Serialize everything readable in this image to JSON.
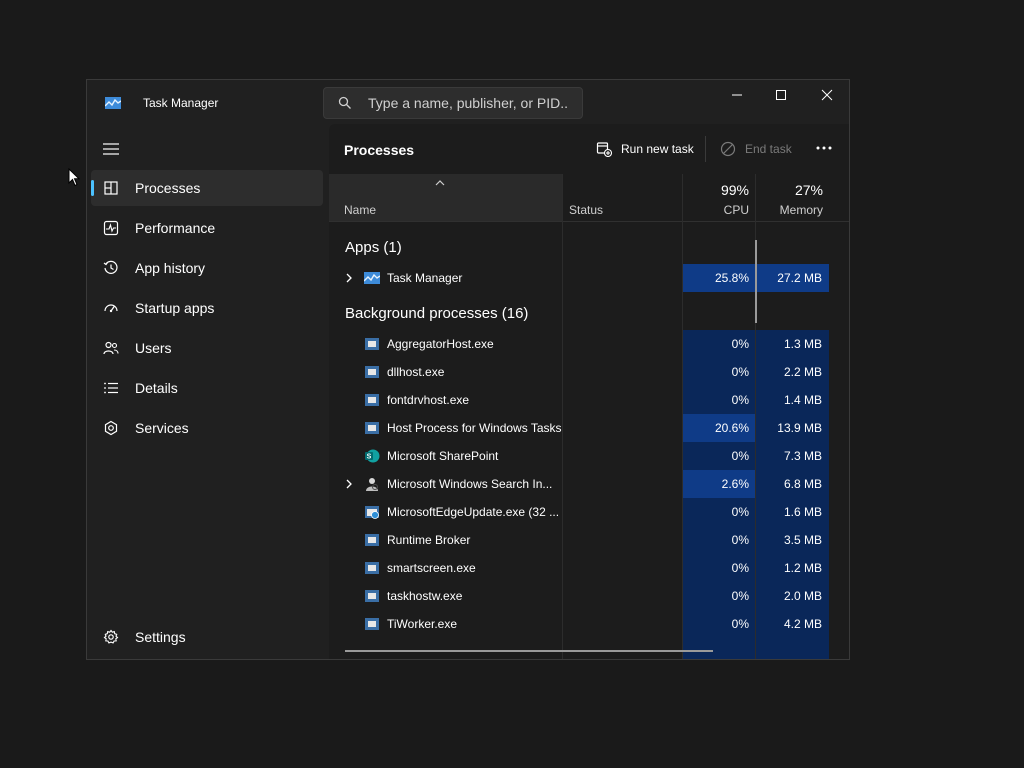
{
  "window": {
    "title": "Task Manager",
    "search_placeholder": "Type a name, publisher, or PID..."
  },
  "sidebar": {
    "items": [
      {
        "label": "Processes",
        "icon": "processes-icon"
      },
      {
        "label": "Performance",
        "icon": "performance-icon"
      },
      {
        "label": "App history",
        "icon": "history-icon"
      },
      {
        "label": "Startup apps",
        "icon": "startup-icon"
      },
      {
        "label": "Users",
        "icon": "users-icon"
      },
      {
        "label": "Details",
        "icon": "details-icon"
      },
      {
        "label": "Services",
        "icon": "services-icon"
      }
    ],
    "settings_label": "Settings",
    "active": "Processes"
  },
  "toolbar": {
    "page_title": "Processes",
    "run_new_task": "Run new task",
    "end_task": "End task"
  },
  "columns": {
    "name": "Name",
    "status": "Status",
    "cpu_label": "CPU",
    "cpu_total": "99%",
    "memory_label": "Memory",
    "memory_total": "27%"
  },
  "groups": {
    "apps": "Apps (1)",
    "background": "Background processes (16)"
  },
  "apps": [
    {
      "name": "Task Manager",
      "cpu": "25.8%",
      "memory": "27.2 MB",
      "expandable": true,
      "icon": "task-manager-icon"
    }
  ],
  "background": [
    {
      "name": "AggregatorHost.exe",
      "cpu": "0%",
      "memory": "1.3 MB",
      "expandable": false,
      "icon": "process-icon"
    },
    {
      "name": "dllhost.exe",
      "cpu": "0%",
      "memory": "2.2 MB",
      "expandable": false,
      "icon": "process-icon"
    },
    {
      "name": "fontdrvhost.exe",
      "cpu": "0%",
      "memory": "1.4 MB",
      "expandable": false,
      "icon": "process-icon"
    },
    {
      "name": "Host Process for Windows Tasks",
      "cpu": "20.6%",
      "memory": "13.9 MB",
      "expandable": false,
      "icon": "process-icon"
    },
    {
      "name": "Microsoft SharePoint",
      "cpu": "0%",
      "memory": "7.3 MB",
      "expandable": false,
      "icon": "sharepoint-icon"
    },
    {
      "name": "Microsoft Windows Search In...",
      "cpu": "2.6%",
      "memory": "6.8 MB",
      "expandable": true,
      "icon": "search-indexer-icon"
    },
    {
      "name": "MicrosoftEdgeUpdate.exe (32 ...",
      "cpu": "0%",
      "memory": "1.6 MB",
      "expandable": false,
      "icon": "edge-update-icon"
    },
    {
      "name": "Runtime Broker",
      "cpu": "0%",
      "memory": "3.5 MB",
      "expandable": false,
      "icon": "process-icon"
    },
    {
      "name": "smartscreen.exe",
      "cpu": "0%",
      "memory": "1.2 MB",
      "expandable": false,
      "icon": "process-icon"
    },
    {
      "name": "taskhostw.exe",
      "cpu": "0%",
      "memory": "2.0 MB",
      "expandable": false,
      "icon": "process-icon"
    },
    {
      "name": "TiWorker.exe",
      "cpu": "0%",
      "memory": "4.2 MB",
      "expandable": false,
      "icon": "process-icon"
    }
  ],
  "colors": {
    "accent": "#4cc2ff",
    "heat_low": "#0a2759",
    "heat_high": "#0f3b87"
  }
}
